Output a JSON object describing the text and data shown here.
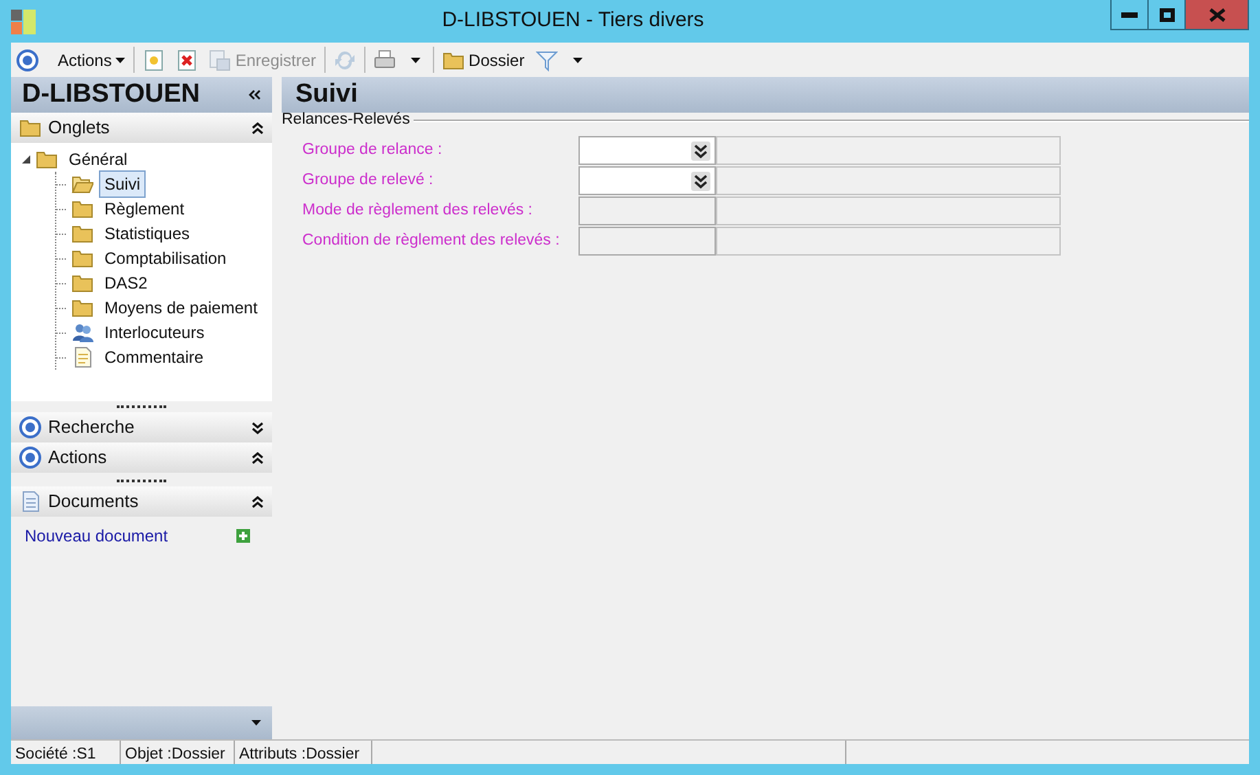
{
  "window": {
    "title": "D-LIBSTOUEN -  Tiers divers"
  },
  "toolbar": [
    {
      "kind": "target",
      "label": "Actions",
      "menu": true,
      "disabled": false
    },
    {
      "kind": "sep"
    },
    {
      "kind": "new",
      "disabled": false
    },
    {
      "kind": "delete",
      "disabled": false
    },
    {
      "kind": "save",
      "label": "Enregistrer",
      "disabled": true
    },
    {
      "kind": "sep"
    },
    {
      "kind": "refresh",
      "disabled": true
    },
    {
      "kind": "sep"
    },
    {
      "kind": "print",
      "menu": true,
      "disabled": false
    },
    {
      "kind": "sep"
    },
    {
      "kind": "folder",
      "label": "Dossier",
      "disabled": false
    },
    {
      "kind": "filter",
      "menu": true,
      "disabled": false
    }
  ],
  "sidebar": {
    "title": "D-LIBSTOUEN",
    "sections": [
      {
        "kind": "folder",
        "title": "Onglets",
        "expanded": true,
        "tree": [
          {
            "label": "Général",
            "kind": "folder",
            "expanded": true,
            "selected": false,
            "children": [
              {
                "label": "Suivi",
                "kind": "folder",
                "selected": true
              },
              {
                "label": "Règlement",
                "kind": "folder",
                "selected": false
              },
              {
                "label": "Statistiques",
                "kind": "folder",
                "selected": false
              },
              {
                "label": "Comptabilisation",
                "kind": "folder",
                "selected": false
              },
              {
                "label": "DAS2",
                "kind": "folder",
                "selected": false
              },
              {
                "label": "Moyens de paiement",
                "kind": "folder",
                "selected": false
              },
              {
                "label": "Interlocuteurs",
                "kind": "people",
                "selected": false
              },
              {
                "label": "Commentaire",
                "kind": "note",
                "selected": false
              }
            ]
          }
        ]
      },
      {
        "kind": "target",
        "title": "Recherche",
        "expanded": false
      },
      {
        "kind": "target",
        "title": "Actions",
        "expanded": true
      },
      {
        "kind": "doc",
        "title": "Documents",
        "expanded": true,
        "links": [
          "Nouveau document"
        ]
      }
    ]
  },
  "form": {
    "title": "Suivi",
    "group": "Relances-Relevés",
    "fields": [
      {
        "label": "Groupe de relance :",
        "kind": "combo"
      },
      {
        "label": "Groupe de relevé :",
        "kind": "combo"
      },
      {
        "label": "Mode de règlement des relevés :",
        "kind": "readonly"
      },
      {
        "label": "Condition de règlement des relevés :",
        "kind": "readonly"
      }
    ]
  },
  "status_bar": [
    "Société :S1",
    "Objet :Dossier",
    "Attributs :Dossier"
  ]
}
